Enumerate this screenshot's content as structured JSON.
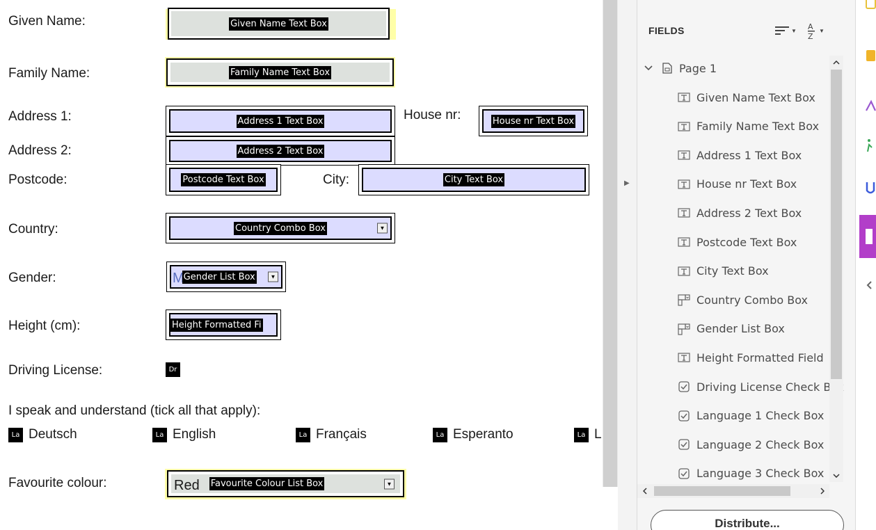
{
  "form": {
    "labels": {
      "given_name": "Given Name:",
      "family_name": "Family Name:",
      "address1": "Address 1:",
      "house_nr": "House nr:",
      "address2": "Address 2:",
      "postcode": "Postcode:",
      "city": "City:",
      "country": "Country:",
      "gender": "Gender:",
      "height": "Height (cm):",
      "driving_license": "Driving License:",
      "languages_prompt": "I speak and understand (tick all that apply):",
      "favourite_colour": "Favourite colour:"
    },
    "field_tags": {
      "given_name": "Given Name Text Box",
      "family_name": "Family Name Text Box",
      "address1": "Address 1 Text Box",
      "house_nr": "House nr Text Box",
      "address2": "Address 2 Text Box",
      "postcode": "Postcode Text Box",
      "city": "City Text Box",
      "country": "Country Combo Box",
      "gender": "Gender List Box",
      "height": "Height Formatted Fi",
      "driving_license": "Dr",
      "favourite_colour": "Favourite Colour List Box"
    },
    "gender_value": "M",
    "favourite_colour_value": "Red",
    "languages": [
      {
        "tag": "La",
        "label": "Deutsch"
      },
      {
        "tag": "La",
        "label": "English"
      },
      {
        "tag": "La",
        "label": "Français"
      },
      {
        "tag": "La",
        "label": "Esperanto"
      },
      {
        "tag": "La",
        "label": "L"
      }
    ]
  },
  "fields_panel": {
    "header": "FIELDS",
    "page": "Page 1",
    "items": [
      {
        "icon": "text-field-icon",
        "label": "Given Name Text Box"
      },
      {
        "icon": "text-field-icon",
        "label": "Family Name Text Box"
      },
      {
        "icon": "text-field-icon",
        "label": "Address 1 Text Box"
      },
      {
        "icon": "text-field-icon",
        "label": "House nr Text Box"
      },
      {
        "icon": "text-field-icon",
        "label": "Address 2 Text Box"
      },
      {
        "icon": "text-field-icon",
        "label": "Postcode Text Box"
      },
      {
        "icon": "text-field-icon",
        "label": "City Text Box"
      },
      {
        "icon": "combo-box-icon",
        "label": "Country Combo Box"
      },
      {
        "icon": "combo-box-icon",
        "label": "Gender List Box"
      },
      {
        "icon": "text-field-icon",
        "label": "Height Formatted Field"
      },
      {
        "icon": "checkbox-icon",
        "label": "Driving License Check Box"
      },
      {
        "icon": "checkbox-icon",
        "label": "Language 1 Check Box"
      },
      {
        "icon": "checkbox-icon",
        "label": "Language 2 Check Box"
      },
      {
        "icon": "checkbox-icon",
        "label": "Language 3 Check Box"
      }
    ],
    "distribute_label": "Distribute..."
  },
  "colors": {
    "gray_field": "#dde1dd",
    "blue_field": "#dcdcff",
    "yellow_highlight": "#ffffa8",
    "panel_bg": "#f5f5f5"
  }
}
